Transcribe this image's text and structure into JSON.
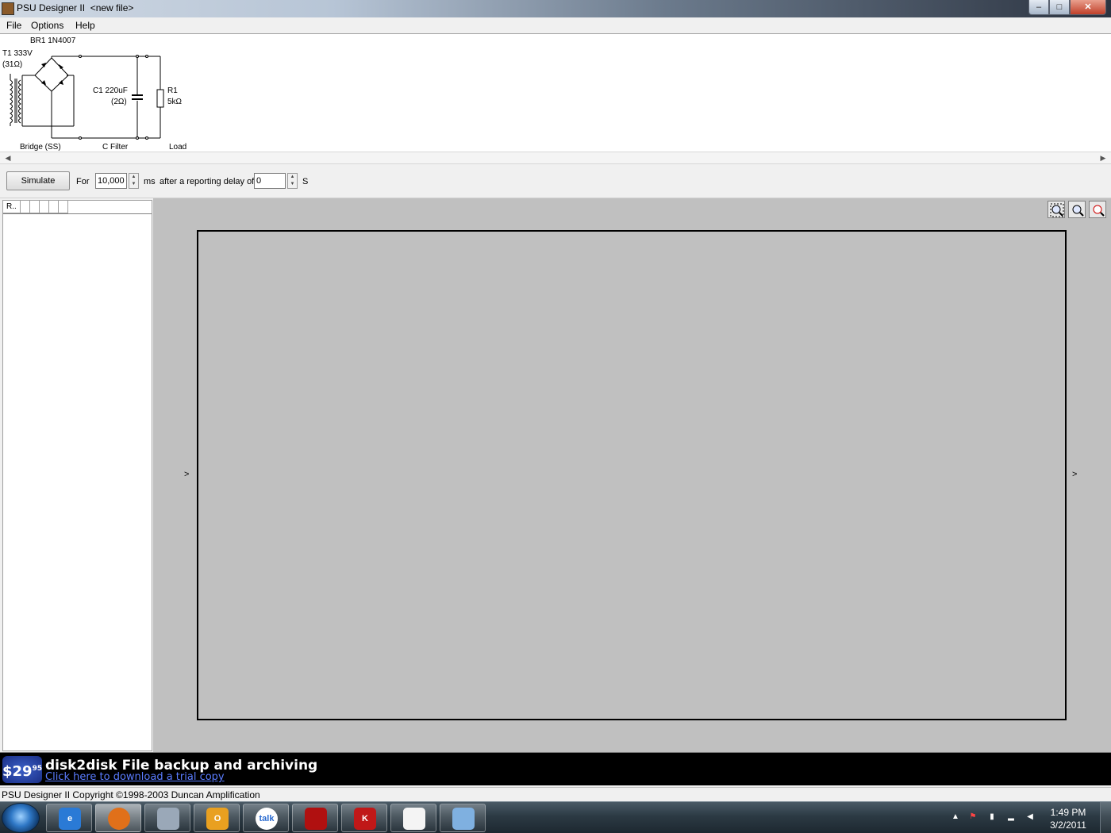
{
  "window": {
    "title": "PSU Designer II  <new file>",
    "minimize": "–",
    "maximize": "□",
    "close": "✕"
  },
  "menu": [
    "File",
    "Options",
    "Help"
  ],
  "schematic": {
    "bridge_label": "BR1 1N4007",
    "transformer_label": "T1 333V",
    "transformer_resistance": "(31Ω)",
    "capacitor_label": "C1 220uF",
    "capacitor_resistance": "(2Ω)",
    "resistor_label": "R1",
    "resistor_value": "5kΩ",
    "stage_bridge": "Bridge (SS)",
    "stage_filter": "C Filter",
    "stage_load": "Load"
  },
  "simulation": {
    "button": "Simulate",
    "for_label": "For",
    "duration_value": "10,000",
    "duration_unit": "ms",
    "delay_label": "after a reporting delay of",
    "delay_value": "0",
    "delay_unit": "S"
  },
  "results_panel": {
    "columns": [
      "R..",
      "",
      "",
      "",
      "",
      ""
    ]
  },
  "plot": {
    "left_marker": ">",
    "right_marker": ">",
    "zoom_buttons": [
      "zoom-fit",
      "zoom-in",
      "zoom-out"
    ]
  },
  "ad": {
    "price": "$29",
    "price_cents": "95",
    "headline": "disk2disk File backup and archiving",
    "link": "Click here to download a trial copy"
  },
  "status": {
    "text": "PSU Designer II  Copyright ©1998-2003 Duncan Amplification"
  },
  "taskbar": {
    "apps": [
      "internet-explorer",
      "firefox",
      "calculator",
      "outlook",
      "google-talk",
      "adobe-reader",
      "kaspersky",
      "app",
      "paint"
    ],
    "talk_label": "talk",
    "time": "1:49 PM",
    "date": "3/2/2011"
  }
}
